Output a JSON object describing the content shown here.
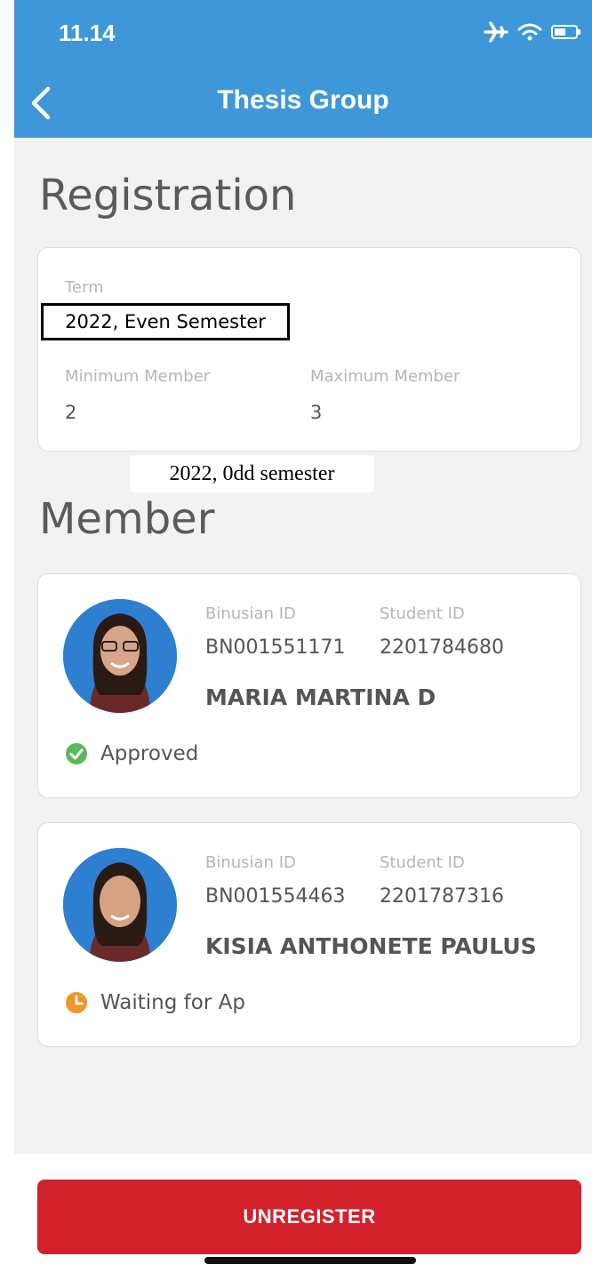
{
  "status_bar": {
    "time": "11.14",
    "icons": [
      "airplane-icon",
      "wifi-icon",
      "battery-icon"
    ]
  },
  "nav": {
    "title": "Thesis Group",
    "back_icon": "chevron-left-icon"
  },
  "registration": {
    "title": "Registration",
    "term_label": "Term",
    "term_value": "2022, Even Semester",
    "min_label": "Minimum Member",
    "min_value": "2",
    "max_label": "Maximum Member",
    "max_value": "3",
    "overlay_note": "2022, 0dd semester"
  },
  "member_section": {
    "title": "Member",
    "members": [
      {
        "binusian_label": "Binusian ID",
        "binusian_id": "BN001551171",
        "student_label": "Student ID",
        "student_id": "2201784680",
        "name": "MARIA MARTINA D",
        "status": "Approved",
        "status_color": "#5cb85c"
      },
      {
        "binusian_label": "Binusian ID",
        "binusian_id": "BN001554463",
        "student_label": "Student ID",
        "student_id": "2201787316",
        "name": "KISIA ANTHONETE PAULUS",
        "status": "Waiting for Ap",
        "status_color": "#f0962b"
      }
    ]
  },
  "actions": {
    "unregister_label": "UNREGISTER",
    "unregister_color": "#d3212b"
  },
  "colors": {
    "header": "#3d97d8",
    "background": "#f2f2f2"
  }
}
